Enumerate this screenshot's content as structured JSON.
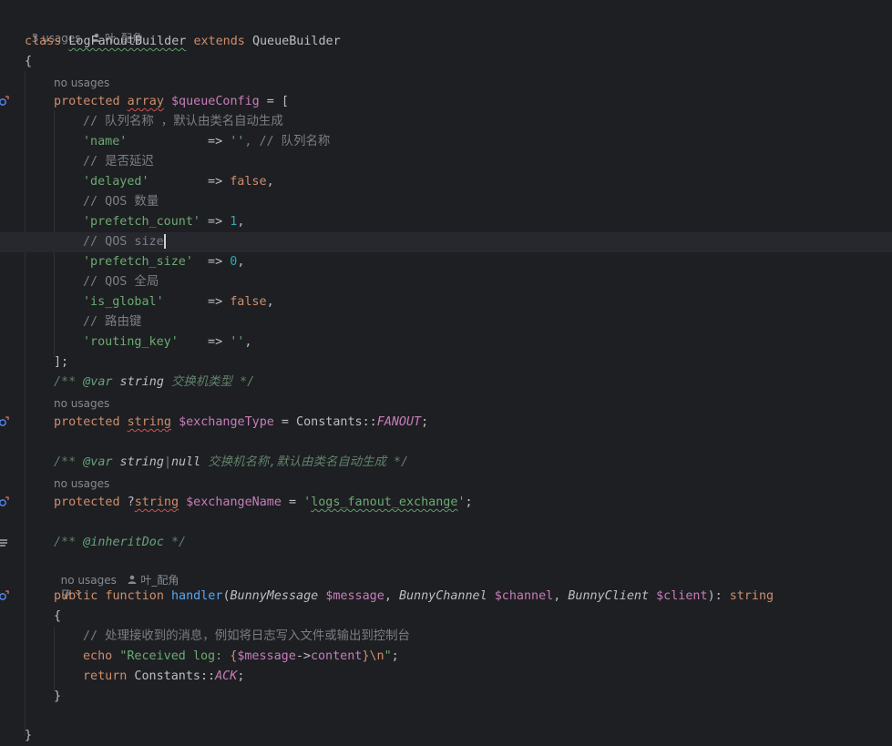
{
  "hints": {
    "class_usages": "3 usages",
    "author": "叶_配角",
    "no_usages": "no usages"
  },
  "code": {
    "l1_kw1": "class",
    "l1_cls": "LogFanoutBuilder",
    "l1_kw2": "extends",
    "l1_parent": "QueueBuilder",
    "brace_open": "{",
    "brace_close": "}",
    "l3_kw": "protected",
    "l3_type": "array",
    "l3_var": "$queueConfig",
    "l3_rest": " = [",
    "c_name": "// 队列名称 ，默认由类名自动生成",
    "k_name": "'name'",
    "pad_name": "           => ",
    "v_name": "''",
    "c_name2": ", // 队列名称",
    "c_delayed": "// 是否延迟",
    "k_delayed": "'delayed'",
    "pad_delayed": "        => ",
    "v_delayed": "false",
    "c_prefetch_count": "// QOS 数量",
    "k_prefetch_count": "'prefetch_count'",
    "pad_prefetch_count": " => ",
    "v_prefetch_count": "1",
    "c_prefetch_size": "// QOS size",
    "k_prefetch_size": "'prefetch_size'",
    "pad_prefetch_size": "  => ",
    "v_prefetch_size": "0",
    "c_global": "// QOS 全局",
    "k_global": "'is_global'",
    "pad_global": "      => ",
    "v_global": "false",
    "c_routing": "// 路由键",
    "k_routing": "'routing_key'",
    "pad_routing": "    => ",
    "v_routing": "''",
    "comma": ",",
    "array_close": "];",
    "doc1_open": "/** ",
    "doc1_tag": "@var",
    "doc1_type": " string ",
    "doc1_text": "交换机类型 */",
    "l_type_kw": "protected",
    "l_type_type": "string",
    "l_type_var": "$exchangeType",
    "l_type_eq": " = Constants::",
    "l_type_const": "FANOUT",
    "semicolon": ";",
    "doc2_open": "/** ",
    "doc2_tag": "@var",
    "doc2_type": " string",
    "doc2_pipe": "|",
    "doc2_null": "null",
    "doc2_text": " 交换机名称,默认由类名自动生成 */",
    "l_name_kw": "protected",
    "l_name_q": " ?",
    "l_name_type": "string",
    "l_name_var": "$exchangeName",
    "l_name_eq": " = ",
    "l_name_val_q1": "'",
    "l_name_val": "logs_fanout_exchange",
    "l_name_val_q2": "'",
    "doc3_open": "/** ",
    "doc3_tag": "@inheritDoc",
    "doc3_close": " */",
    "fn_kw1": "public",
    "fn_kw2": "function",
    "fn_name": "handler",
    "fn_p1_type": "BunnyMessage",
    "fn_p1_var": "$message",
    "fn_p2_type": "BunnyChannel",
    "fn_p2_var": "$channel",
    "fn_p3_type": "BunnyClient",
    "fn_p3_var": "$client",
    "fn_ret": "string",
    "body_cmt": "// 处理接收到的消息，例如将日志写入文件或输出到控制台",
    "echo_kw": "echo",
    "echo_str1": "\"Received log: ",
    "echo_brace1": "{",
    "echo_var": "$message",
    "echo_arrow": "->",
    "echo_prop": "content",
    "echo_brace2": "}",
    "echo_esc": "\\n",
    "echo_str2": "\"",
    "ret_kw": "return",
    "ret_cls": " Constants::",
    "ret_const": "ACK"
  }
}
